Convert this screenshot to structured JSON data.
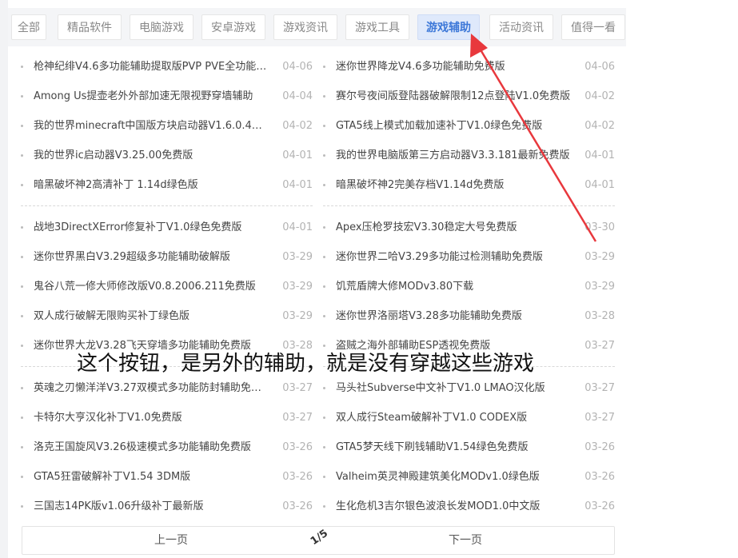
{
  "tabs": [
    {
      "label": "全部",
      "active": false
    },
    {
      "label": "精品软件",
      "active": false
    },
    {
      "label": "电脑游戏",
      "active": false
    },
    {
      "label": "安卓游戏",
      "active": false
    },
    {
      "label": "游戏资讯",
      "active": false
    },
    {
      "label": "游戏工具",
      "active": false
    },
    {
      "label": "游戏辅助",
      "active": true
    },
    {
      "label": "活动资讯",
      "active": false
    },
    {
      "label": "值得一看",
      "active": false
    }
  ],
  "left_group1": [
    {
      "title": "枪神纪绯V4.6多功能辅助提取版PVP PVE全功能辅助",
      "date": "04-06"
    },
    {
      "title": "Among Us提壶老外外部加速无限视野穿墙辅助",
      "date": "04-04"
    },
    {
      "title": "我的世界minecraft中国版方块启动器V1.6.0.4最新版",
      "date": "04-02"
    },
    {
      "title": "我的世界ic启动器V3.25.00免费版",
      "date": "04-01"
    },
    {
      "title": "暗黑破坏神2高清补丁 1.14d绿色版",
      "date": "04-01"
    }
  ],
  "right_group1": [
    {
      "title": "迷你世界降龙V4.6多功能辅助免费版",
      "date": "04-06"
    },
    {
      "title": "赛尔号夜间版登陆器破解限制12点登陆V1.0免费版",
      "date": "04-02"
    },
    {
      "title": "GTA5线上模式加载加速补丁V1.0绿色免费版",
      "date": "04-02"
    },
    {
      "title": "我的世界电脑版第三方启动器V3.3.181最新免费版",
      "date": "04-01"
    },
    {
      "title": "暗黑破坏神2完美存档V1.14d免费版",
      "date": "04-01"
    }
  ],
  "left_group2": [
    {
      "title": "战地3DirectXError修复补丁V1.0绿色免费版",
      "date": "04-01"
    },
    {
      "title": "迷你世界黑白V3.29超级多功能辅助破解版",
      "date": "03-29"
    },
    {
      "title": "鬼谷八荒一修大师修改版V0.8.2006.211免费版",
      "date": "03-29"
    },
    {
      "title": "双人成行破解无限购买补丁绿色版",
      "date": "03-29"
    },
    {
      "title": "迷你世界大龙V3.28飞天穿墙多功能辅助免费版",
      "date": "03-28"
    }
  ],
  "right_group2": [
    {
      "title": "Apex压枪罗技宏V3.30稳定大号免费版",
      "date": "03-30"
    },
    {
      "title": "迷你世界二哈V3.29多功能过检测辅助免费版",
      "date": "03-29"
    },
    {
      "title": "饥荒盾牌大修MODv3.80下载",
      "date": "03-29"
    },
    {
      "title": "迷你世界洛丽塔V3.28多功能辅助免费版",
      "date": "03-28"
    },
    {
      "title": "盗贼之海外部辅助ESP透视免费版",
      "date": "03-27"
    }
  ],
  "left_group3": [
    {
      "title": "英魂之刃懒洋洋V3.27双模式多功能防封辅助免费版",
      "date": "03-27"
    },
    {
      "title": "卡特尔大亨汉化补丁V1.0免费版",
      "date": "03-27"
    },
    {
      "title": "洛克王国旋风V3.26极速模式多功能辅助免费版",
      "date": "03-26"
    },
    {
      "title": "GTA5狂雷破解补丁V1.54 3DM版",
      "date": "03-26"
    },
    {
      "title": "三国志14PK版v1.06升级补丁最新版",
      "date": "03-26"
    }
  ],
  "right_group3": [
    {
      "title": "马头社Subverse中文补丁V1.0 LMAO汉化版",
      "date": "03-27"
    },
    {
      "title": "双人成行Steam破解补丁V1.0 CODEX版",
      "date": "03-27"
    },
    {
      "title": "GTA5梦天线下刷钱辅助V1.54绿色免费版",
      "date": "03-26"
    },
    {
      "title": "Valheim英灵神殿建筑美化MODv1.0绿色版",
      "date": "03-26"
    },
    {
      "title": "生化危机3吉尔银色波浪长发MOD1.0中文版",
      "date": "03-26"
    }
  ],
  "pager": {
    "prev": "上一页",
    "page": "1/5",
    "next": "下一页"
  },
  "annotation": {
    "text": "这个按钮，是另外的辅助，就是没有穿越这些游戏",
    "color": "#e8383d"
  }
}
